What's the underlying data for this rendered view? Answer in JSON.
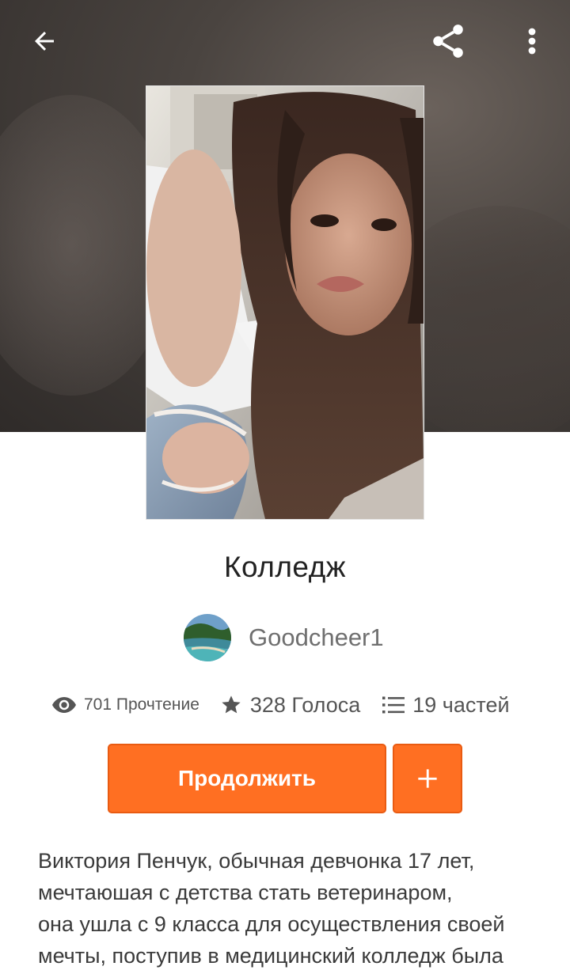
{
  "header": {
    "back_icon": "arrow-left-icon",
    "share_icon": "share-icon",
    "more_icon": "more-vertical-icon"
  },
  "story": {
    "title": "Колледж",
    "cover_image": "portrait-photo"
  },
  "author": {
    "name": "Goodcheer1",
    "avatar": "landscape-beach-photo"
  },
  "stats": {
    "reads": "701 Прочтение",
    "votes": "328 Голоса",
    "parts": "19 частей"
  },
  "actions": {
    "continue_label": "Продолжить",
    "add_icon": "plus-icon"
  },
  "description": {
    "lines": [
      "Виктория Пенчук, обычная девчонка 17 лет,",
      "мечтаюшая с детства стать ветеринаром,",
      "она ушла с 9 класса для осуществления своей",
      "мечты, поступив в медицинский колледж была"
    ]
  },
  "colors": {
    "accent": "#ff6f22",
    "accent_border": "#e95b12",
    "text_dark": "#222222",
    "text_muted": "#6f6f6f"
  }
}
